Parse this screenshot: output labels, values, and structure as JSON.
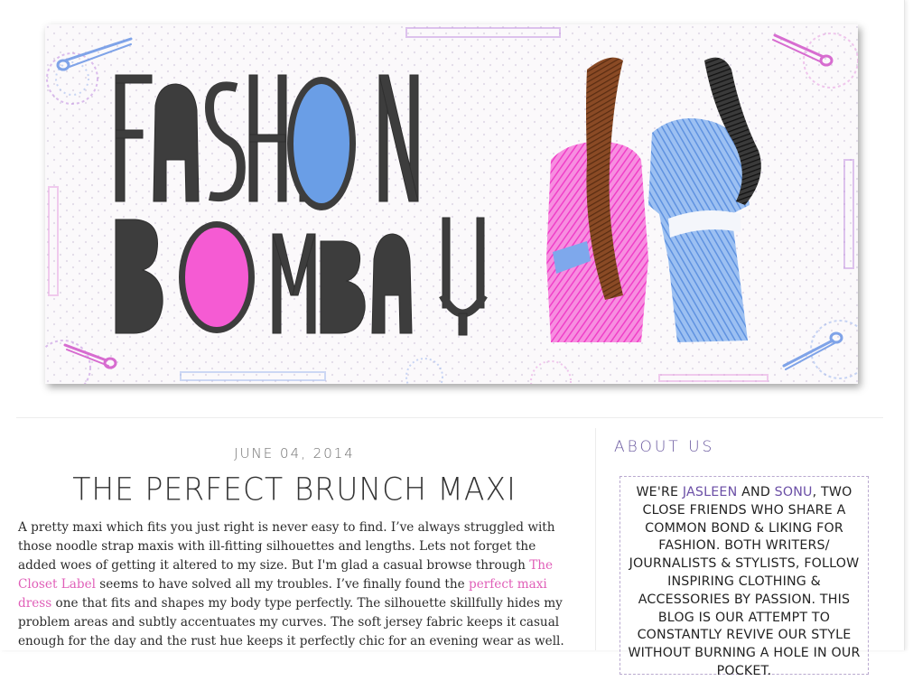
{
  "header": {
    "logo_line1": "FASHiON",
    "logo_line2": "BOMBAY",
    "colors": {
      "pink": "#f55bd3",
      "blue": "#6a9ee6",
      "dark": "#3d3d3d",
      "brown": "#6b3a1d"
    }
  },
  "post": {
    "date": "JUNE 04, 2014",
    "title": "THE PERFECT BRUNCH MAXI",
    "p1_before_link1": "A pretty maxi which fits you just right is never easy to find. I’ve always struggled with those noodle strap maxis with ill-fitting silhouettes and lengths. Lets not forget the added woes of getting it altered to my size. But I'm glad a casual browse through ",
    "link1": "The Closet Label",
    "p1_between": " seems to have solved all my troubles. I’ve finally found the ",
    "link2": "perfect maxi dress",
    "p1_after_link2": " one that fits and shapes my body type perfectly. The silhouette skillfully hides my problem areas and subtly accentuates my curves. The soft jersey fabric keeps it casual enough for the day and the rust hue keeps it perfectly chic for an evening wear as well."
  },
  "sidebar": {
    "heading": "ABOUT US",
    "about_intro": "WE'RE ",
    "name1": "JASLEEN",
    "and": " AND ",
    "name2": "SONU",
    "about_rest": ", TWO CLOSE FRIENDS WHO SHARE A COMMON BOND & LIKING FOR FASHION. BOTH WRITERS/ JOURNALISTS & STYLISTS, FOLLOW INSPIRING CLOTHING & ACCESSORIES BY PASSION. THIS BLOG IS OUR ATTEMPT TO CONSTANTLY REVIVE OUR STYLE WITHOUT BURNING A HOLE IN OUR POCKET."
  }
}
